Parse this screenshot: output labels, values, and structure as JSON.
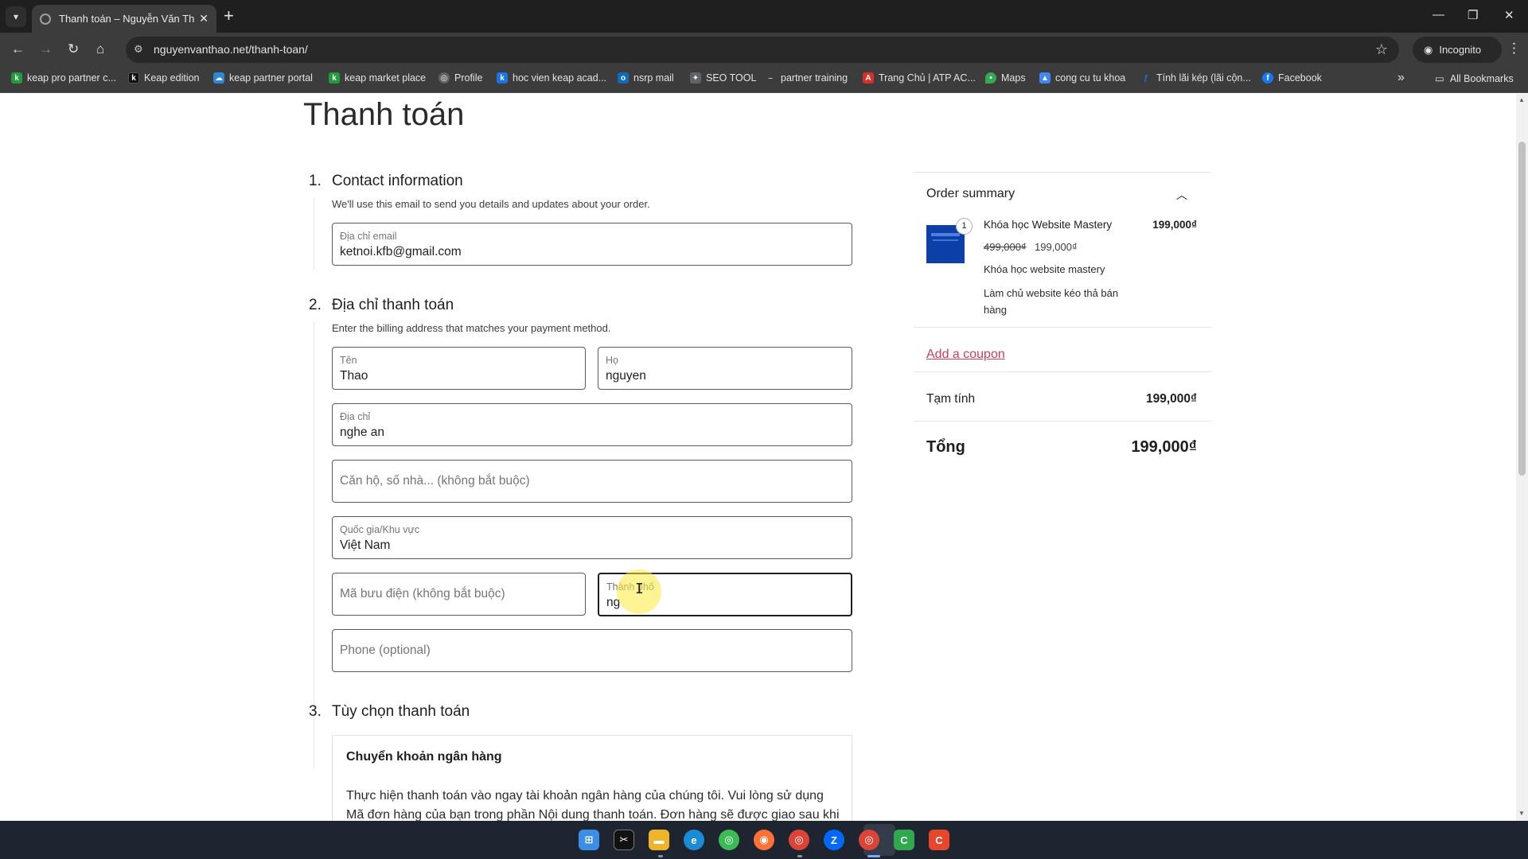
{
  "browser": {
    "tab_title": "Thanh toán – Nguyễn Văn Thảo",
    "url": "nguyenvanthao.net/thanh-toan/",
    "incognito_label": "Incognito",
    "bookmarks": [
      {
        "label": "keap pro partner c...",
        "icon": "keap-icon",
        "color": "#1f9d3a"
      },
      {
        "label": "Keap edition",
        "icon": "keap-icon",
        "color": "#111111"
      },
      {
        "label": "keap partner portal",
        "icon": "cloud-icon",
        "color": "#2b88d8"
      },
      {
        "label": "keap market place",
        "icon": "keap-icon",
        "color": "#1f9d3a"
      },
      {
        "label": "Profile",
        "icon": "globe-icon",
        "color": "#5f6368"
      },
      {
        "label": "hoc vien keap acad...",
        "icon": "k-icon",
        "color": "#1a73e8"
      },
      {
        "label": "nsrp mail",
        "icon": "outlook-icon",
        "color": "#0f6cbd"
      },
      {
        "label": "SEO TOOL",
        "icon": "seo-icon",
        "color": "#5f6368"
      },
      {
        "label": "partner training",
        "icon": "dash-icon",
        "color": "#5f6368"
      },
      {
        "label": "Trang Chủ | ATP AC...",
        "icon": "atp-icon",
        "color": "#d93025"
      },
      {
        "label": "Maps",
        "icon": "map-pin-icon",
        "color": "#34a853"
      },
      {
        "label": "cong cu tu khoa",
        "icon": "ads-icon",
        "color": "#4285f4"
      },
      {
        "label": "Tính lãi kép (lãi cộn...",
        "icon": "f-icon",
        "color": "#1a73e8"
      },
      {
        "label": "Facebook",
        "icon": "facebook-icon",
        "color": "#1877f2"
      }
    ],
    "all_bookmarks_label": "All Bookmarks"
  },
  "page": {
    "title": "Thanh toán",
    "contact": {
      "num": "1.",
      "title": "Contact information",
      "desc": "We'll use this email to send you details and updates about your order.",
      "email_label": "Địa chỉ email",
      "email_value": "ketnoi.kfb@gmail.com"
    },
    "billing": {
      "num": "2.",
      "title": "Địa chỉ thanh toán",
      "desc": "Enter the billing address that matches your payment method.",
      "first_name_label": "Tên",
      "first_name_value": "Thao",
      "last_name_label": "Họ",
      "last_name_value": "nguyen",
      "address_label": "Địa chỉ",
      "address_value": "nghe an",
      "apartment_placeholder": "Căn hộ, số nhà... (không bắt buộc)",
      "country_label": "Quốc gia/Khu vực",
      "country_value": "Việt Nam",
      "postcode_placeholder": "Mã bưu điện (không bắt buộc)",
      "city_label": "Thành phố",
      "city_value": "ng",
      "phone_placeholder": "Phone (optional)"
    },
    "payment": {
      "num": "3.",
      "title": "Tùy chọn thanh toán",
      "method_title": "Chuyển khoản ngân hàng",
      "method_desc": "Thực hiện thanh toán vào ngay tài khoản ngân hàng của chúng tôi. Vui lòng sử dụng Mã đơn hàng của bạn trong phần Nội dung thanh toán. Đơn hàng sẽ được giao sau khi"
    }
  },
  "summary": {
    "heading": "Order summary",
    "item": {
      "quantity": "1",
      "name": "Khóa học Website Mastery",
      "line_total": "199,000₫",
      "regular_price": "499,000₫",
      "sale_price": "199,000₫",
      "desc1": "Khóa học website mastery",
      "desc2": "Làm chủ website kéo thả bán hàng"
    },
    "coupon_label": "Add a coupon",
    "subtotal_label": "Tạm tính",
    "subtotal_value": "199,000₫",
    "total_label": "Tổng",
    "total_value": "199,000₫"
  },
  "colors": {
    "coupon_link": "#c94059",
    "active_field_border": "#1e1e1e",
    "cursor_highlight": "#ffeb3b"
  }
}
